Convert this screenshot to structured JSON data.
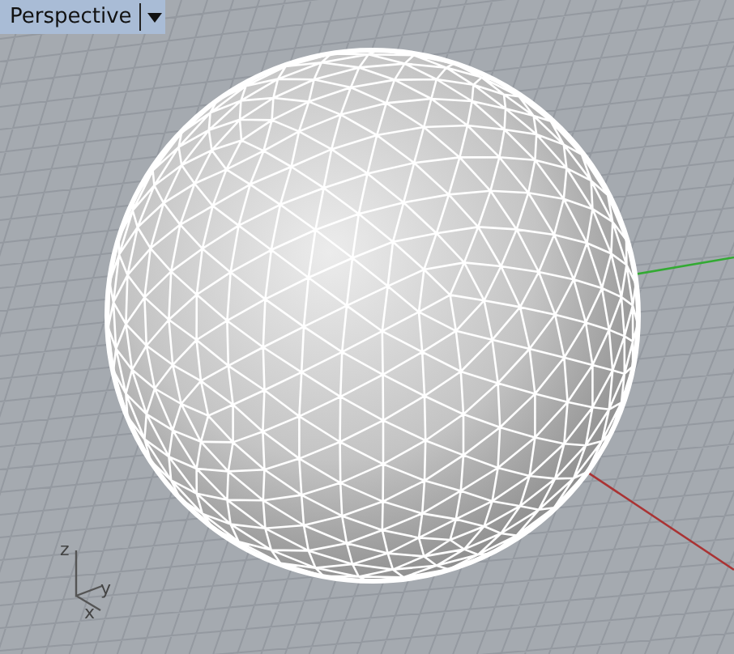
{
  "viewport": {
    "title": "Perspective",
    "axis_labels": [
      "z",
      "y",
      "x"
    ]
  }
}
